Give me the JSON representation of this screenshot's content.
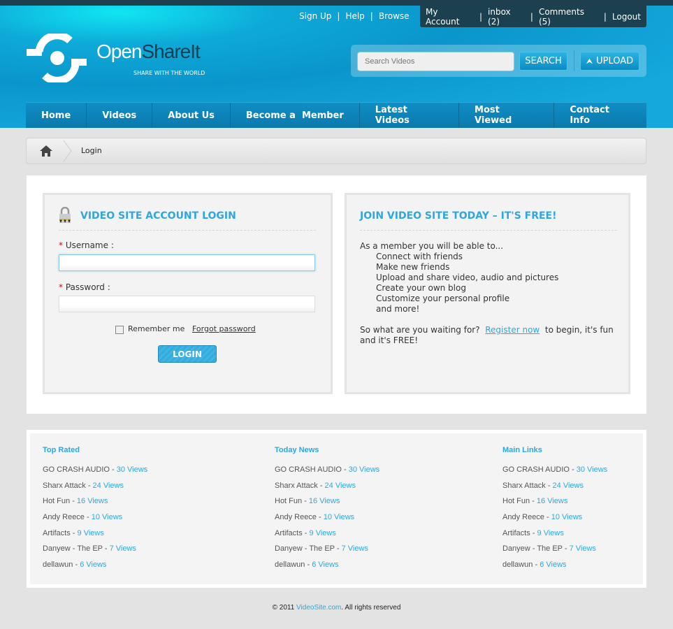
{
  "top_links_left": [
    "Sign Up",
    "Help",
    "Browse"
  ],
  "top_links_right": [
    "My Account",
    "inbox (2)",
    "Comments (5)",
    "Logout"
  ],
  "logo": {
    "name_a": "Open",
    "name_b": "ShareIt",
    "tagline": "SHARE WITH THE WORLD"
  },
  "search": {
    "placeholder": "Search Videos",
    "button": "SEARCH",
    "upload": "UPLOAD"
  },
  "nav": [
    "Home",
    "Videos",
    "About Us",
    "Become a  Member",
    "Latest Videos",
    "Most Viewed",
    "Contact Info"
  ],
  "breadcrumb": {
    "current": "Login"
  },
  "login": {
    "title": "VIDEO SITE ACCOUNT LOGIN",
    "username_label": "Username :",
    "password_label": "Password :",
    "required": "*",
    "remember": "Remember me",
    "forgot": "Forgot password",
    "button": "LOGIN"
  },
  "join": {
    "title": "JOIN VIDEO SITE TODAY – IT'S FREE!",
    "intro": "As a member you will be able to...",
    "benefits": [
      "Connect with friends",
      "Make new friends",
      "Upload and share video, audio and pictures",
      "Create your own blog",
      "Customize your personal profile",
      "and more!"
    ],
    "cta_before": "So what are you waiting for?",
    "cta_link": "Register now",
    "cta_after": "to begin, it's fun and it's FREE!"
  },
  "footer_columns": [
    {
      "title": "Top Rated",
      "items": [
        {
          "name": "GO CRASH AUDIO",
          "views": "30 Views"
        },
        {
          "name": "Sharx Attack",
          "views": "24 Views"
        },
        {
          "name": "Hot Fun",
          "views": "16 Views"
        },
        {
          "name": "Andy Reece",
          "views": "10 Views"
        },
        {
          "name": "Artifacts",
          "views": "9 Views"
        },
        {
          "name": "Danyew - The EP",
          "views": "7 Views"
        },
        {
          "name": "dellawun",
          "views": "6 Views"
        }
      ]
    },
    {
      "title": "Today News",
      "items": [
        {
          "name": "GO CRASH AUDIO",
          "views": "30 Views"
        },
        {
          "name": "Sharx Attack",
          "views": "24 Views"
        },
        {
          "name": "Hot Fun",
          "views": "16 Views"
        },
        {
          "name": "Andy Reece",
          "views": "10 Views"
        },
        {
          "name": "Artifacts",
          "views": "9 Views"
        },
        {
          "name": "Danyew - The EP",
          "views": "7 Views"
        },
        {
          "name": "dellawun",
          "views": "6 Views"
        }
      ]
    },
    {
      "title": "Main Links",
      "items": [
        {
          "name": "GO CRASH AUDIO",
          "views": "30 Views"
        },
        {
          "name": "Sharx Attack",
          "views": "24 Views"
        },
        {
          "name": "Hot Fun",
          "views": "16 Views"
        },
        {
          "name": "Andy Reece",
          "views": "10 Views"
        },
        {
          "name": "Artifacts",
          "views": "9 Views"
        },
        {
          "name": "Danyew - The EP",
          "views": "7 Views"
        },
        {
          "name": "dellawun",
          "views": "6 Views"
        }
      ]
    }
  ],
  "copyright": {
    "before": "© 2011 ",
    "link": "VideoSite.com",
    "after": ". All rights reserved"
  }
}
